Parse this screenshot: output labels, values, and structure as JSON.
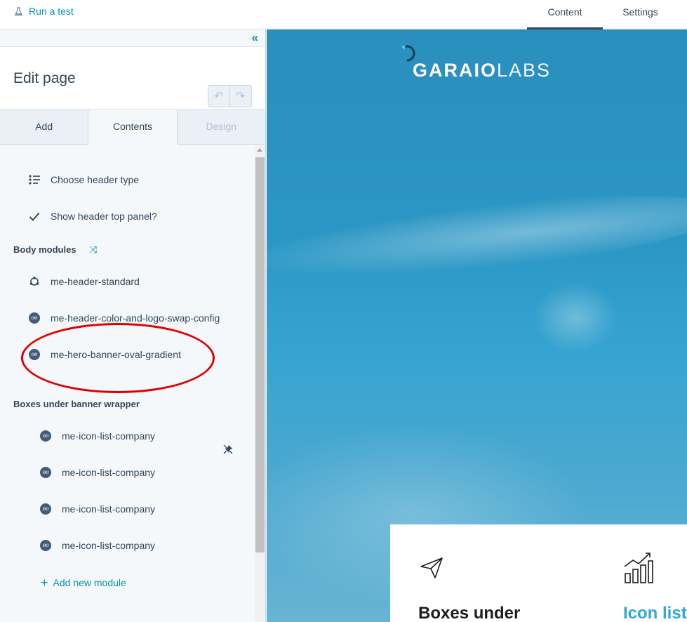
{
  "topbar": {
    "run_test": "Run a test",
    "tabs": [
      {
        "label": "Content",
        "active": true
      },
      {
        "label": "Settings",
        "active": false
      }
    ]
  },
  "sidebar": {
    "collapse_icon": "double-chevron-left-icon",
    "title": "Edit page",
    "undo_icon": "undo-icon",
    "redo_icon": "redo-icon",
    "tabs": [
      {
        "label": "Add",
        "state": "normal"
      },
      {
        "label": "Contents",
        "state": "active"
      },
      {
        "label": "Design",
        "state": "disabled"
      }
    ],
    "header_items": [
      {
        "label": "Choose header type",
        "icon": "list-settings-icon"
      },
      {
        "label": "Show header top panel?",
        "icon": "checkmark-icon"
      }
    ],
    "body_modules": {
      "title": "Body modules",
      "sort_icon": "sort-icon",
      "items": [
        {
          "label": "me-header-standard",
          "icon": "module-outline-icon"
        },
        {
          "label": "me-header-color-and-logo-swap-config",
          "icon": "module-icon"
        },
        {
          "label": "me-hero-banner-oval-gradient",
          "icon": "module-icon"
        }
      ]
    },
    "boxes_wrapper": {
      "title": "Boxes under banner wrapper",
      "items": [
        {
          "label": "me-icon-list-company"
        },
        {
          "label": "me-icon-list-company"
        },
        {
          "label": "me-icon-list-company"
        },
        {
          "label": "me-icon-list-company"
        }
      ]
    },
    "add_module": "Add new module"
  },
  "preview": {
    "logo_bold": "GARAIO",
    "logo_light": "LABS",
    "card": {
      "heading_left": "Boxes under",
      "heading_right": "Icon list"
    }
  },
  "colors": {
    "accent": "#0091ae",
    "highlight_oval": "#e00000",
    "preview_blue": "#2a8fbd",
    "card_heading_blue": "#2fa8d8"
  }
}
